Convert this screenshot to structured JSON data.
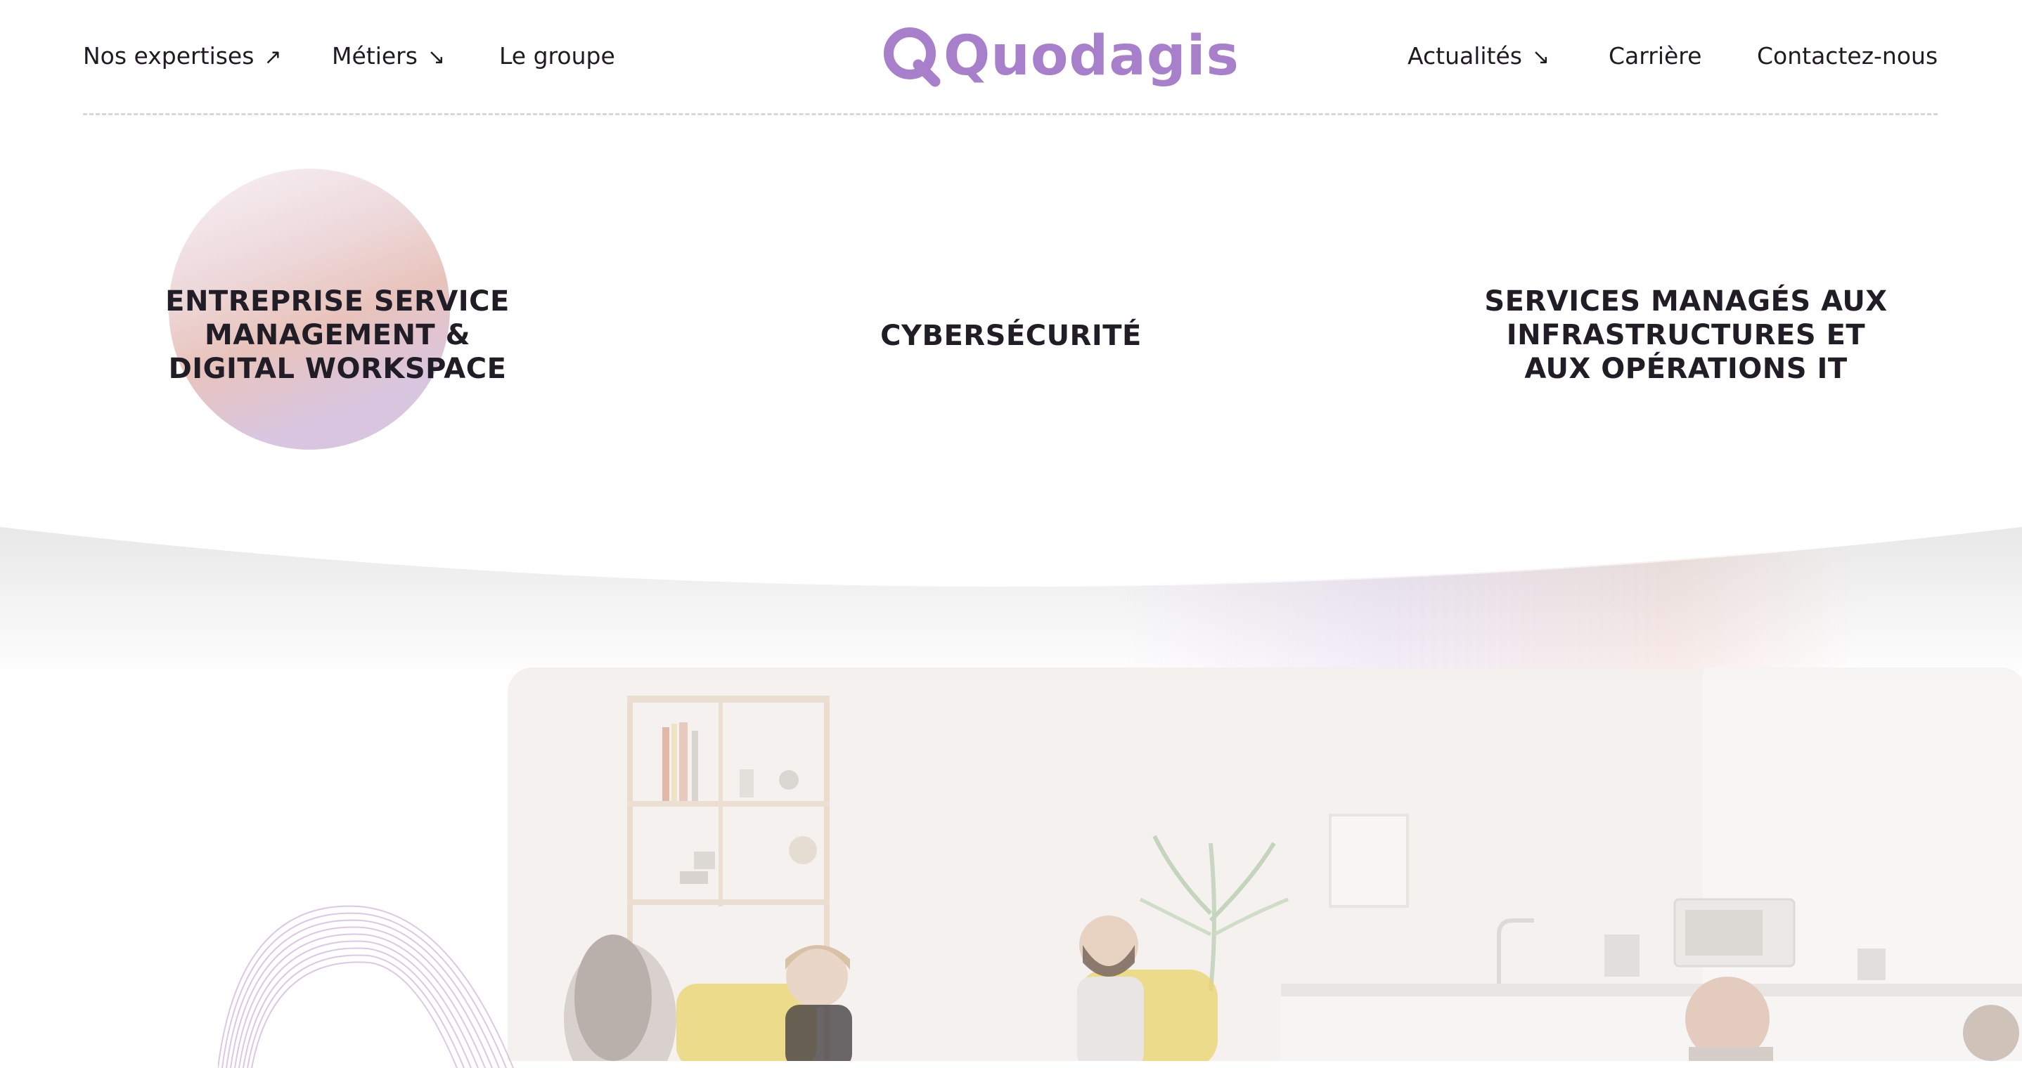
{
  "header": {
    "nav_left": [
      {
        "label": "Nos expertises",
        "arrow": "↗"
      },
      {
        "label": "Métiers",
        "arrow": "↘"
      },
      {
        "label": "Le groupe"
      }
    ],
    "logo_text": "Quodagis",
    "nav_right": [
      {
        "label": "Actualités",
        "arrow": "↘"
      },
      {
        "label": "Carrière"
      },
      {
        "label": "Contactez-nous"
      }
    ]
  },
  "expertises_menu": {
    "items": [
      {
        "lines": [
          "ENTREPRISE SERVICE",
          "MANAGEMENT &",
          "DIGITAL WORKSPACE"
        ],
        "active": true
      },
      {
        "lines": [
          "CYBERSÉCURITÉ"
        ],
        "active": false
      },
      {
        "lines": [
          "SERVICES MANAGÉS AUX",
          "INFRASTRUCTURES ET",
          "AUX OPÉRATIONS IT"
        ],
        "active": false
      }
    ]
  },
  "colors": {
    "brand": "#a77fca",
    "text": "#1f1b24",
    "divider": "#d8d5dc",
    "orb_peach": "#e7c0b8",
    "orb_lilac": "#d8c0de",
    "chair_yellow": "#e9d36a"
  },
  "icons": {
    "nav_arrow_up_right": "arrow-up-right-icon",
    "nav_arrow_down_right": "arrow-down-right-icon"
  }
}
